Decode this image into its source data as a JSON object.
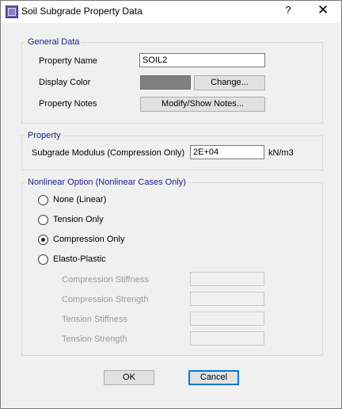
{
  "window": {
    "title": "Soil Subgrade Property Data",
    "help_label": "?",
    "close_label": "✕"
  },
  "general": {
    "legend": "General Data",
    "property_name_label": "Property Name",
    "property_name_value": "SOIL2",
    "display_color_label": "Display Color",
    "display_color_value": "#808080",
    "change_button": "Change...",
    "property_notes_label": "Property Notes",
    "notes_button": "Modify/Show Notes..."
  },
  "property": {
    "legend": "Property",
    "modulus_label": "Subgrade Modulus  (Compression Only)",
    "modulus_value": "2E+04",
    "modulus_unit": "kN/m3"
  },
  "nonlinear": {
    "legend": "Nonlinear Option  (Nonlinear Cases Only)",
    "selected": "Compression Only",
    "options": [
      "None (Linear)",
      "Tension Only",
      "Compression Only",
      "Elasto-Plastic"
    ],
    "fields": [
      {
        "label": "Compression Stiffness",
        "value": ""
      },
      {
        "label": "Compression Strength",
        "value": ""
      },
      {
        "label": "Tension Stiffness",
        "value": ""
      },
      {
        "label": "Tension Strength",
        "value": ""
      }
    ]
  },
  "buttons": {
    "ok": "OK",
    "cancel": "Cancel"
  }
}
